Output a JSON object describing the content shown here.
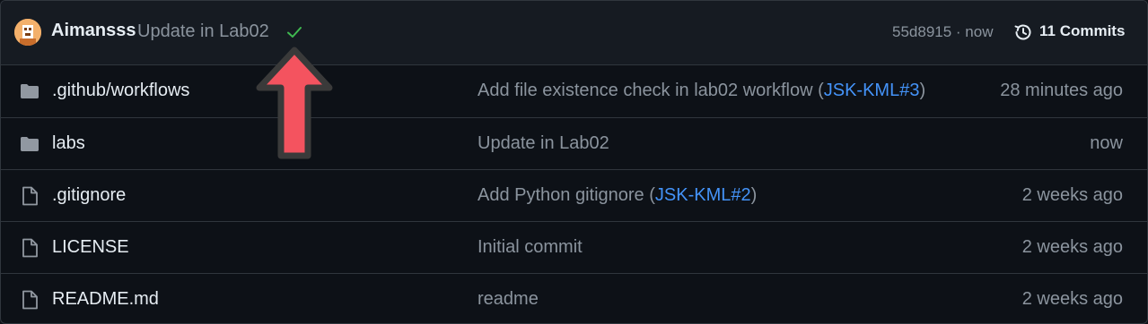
{
  "header": {
    "author": "Aimansss",
    "commit_message": "Update in Lab02",
    "sha_time": "55d8915 · now",
    "commits_label": "11 Commits"
  },
  "files": [
    {
      "name": ".github/workflows",
      "type": "folder",
      "msg_before": "Add file existence check in lab02 workflow (",
      "link": "JSK-KML#3",
      "msg_after": ")",
      "time": "28 minutes ago"
    },
    {
      "name": "labs",
      "type": "folder",
      "msg_before": "Update in Lab02",
      "link": "",
      "msg_after": "",
      "time": "now"
    },
    {
      "name": ".gitignore",
      "type": "file",
      "msg_before": "Add Python gitignore (",
      "link": "JSK-KML#2",
      "msg_after": ")",
      "time": "2 weeks ago"
    },
    {
      "name": "LICENSE",
      "type": "file",
      "msg_before": "Initial commit",
      "link": "",
      "msg_after": "",
      "time": "2 weeks ago"
    },
    {
      "name": "README.md",
      "type": "file",
      "msg_before": "readme",
      "link": "",
      "msg_after": "",
      "time": "2 weeks ago"
    }
  ],
  "colors": {
    "background": "#0d1117",
    "header_bg": "#161b22",
    "border": "#30363d",
    "muted": "#8b949e",
    "link": "#4493f8",
    "check": "#3fb950",
    "arrow": "#f4535f"
  }
}
